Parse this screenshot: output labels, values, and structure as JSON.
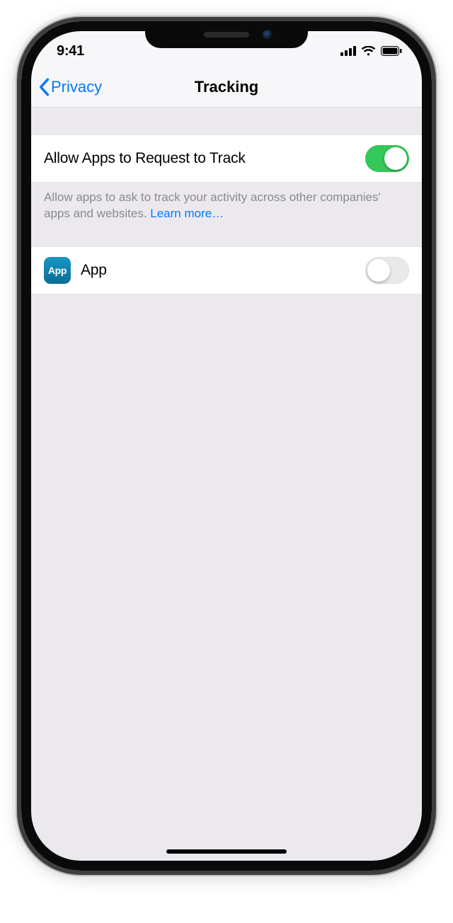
{
  "status": {
    "time": "9:41"
  },
  "nav": {
    "back": "Privacy",
    "title": "Tracking"
  },
  "main_toggle": {
    "label": "Allow Apps to Request to Track",
    "on": true
  },
  "footer": {
    "text": "Allow apps to ask to track your activity across other companies' apps and websites. ",
    "link": "Learn more…"
  },
  "app_row": {
    "icon_text": "App",
    "label": "App",
    "on": false
  }
}
